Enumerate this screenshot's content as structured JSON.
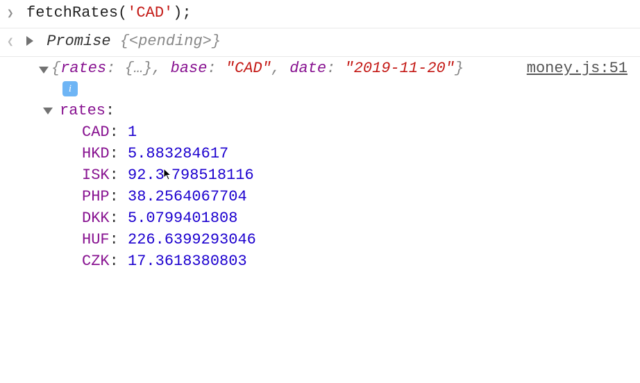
{
  "input": {
    "fn": "fetchRates",
    "openParen": "(",
    "arg": "'CAD'",
    "closeParen": ")",
    "semicolon": ";"
  },
  "return": {
    "typeName": "Promise ",
    "preview": "{<pending>}"
  },
  "log": {
    "sourceLink": "money.js:51",
    "summaryOpen": "{",
    "ratesKey": "rates",
    "ratesPreview": "{…}",
    "baseKey": "base",
    "baseVal": "\"CAD\"",
    "dateKey": "date",
    "dateVal": "\"2019-11-20\"",
    "summaryClose": "}",
    "ratesLabel": "rates",
    "rates": [
      {
        "key": "CAD",
        "value": "1"
      },
      {
        "key": "HKD",
        "value": "5.883284617"
      },
      {
        "key": "ISK",
        "value": "92.3798518116"
      },
      {
        "key": "PHP",
        "value": "38.2564067704"
      },
      {
        "key": "DKK",
        "value": "5.0799401808"
      },
      {
        "key": "HUF",
        "value": "226.6399293046"
      },
      {
        "key": "CZK",
        "value": "17.3618380803"
      }
    ]
  },
  "glyphs": {
    "promptRight": "❯",
    "promptLeft": "❮"
  }
}
